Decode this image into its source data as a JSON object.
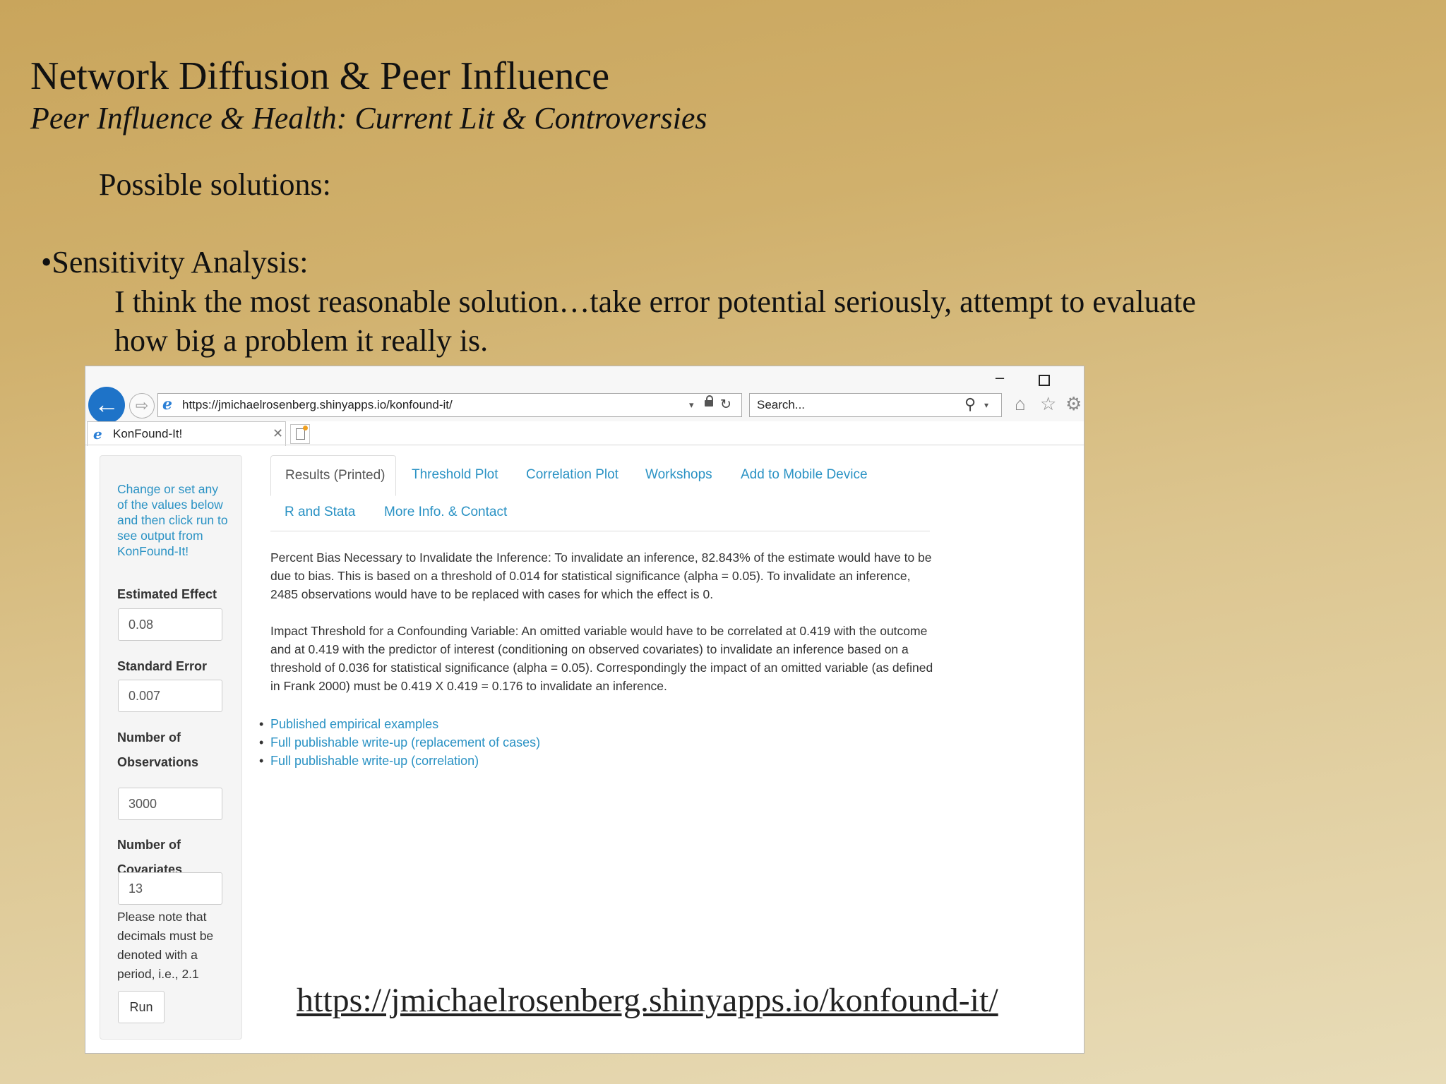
{
  "slide": {
    "title": "Network Diffusion & Peer Influence",
    "subtitle": "Peer Influence & Health: Current Lit & Controversies",
    "possible": "Possible solutions:",
    "sensitivity_heading": "•Sensitivity Analysis:",
    "sensitivity_body": "I think the most reasonable solution…take error potential seriously, attempt to evaluate how big a problem it really is.",
    "footer_url": "https://jmichaelrosenberg.shinyapps.io/konfound-it/"
  },
  "browser": {
    "minimize_glyph": "–",
    "back_glyph": "←",
    "forward_glyph": "⇨",
    "address_icon": "e",
    "address": "https://jmichaelrosenberg.shinyapps.io/konfound-it/",
    "address_dropdown_glyph": "▾",
    "refresh_glyph": "↻",
    "search_placeholder": "Search...",
    "search_glyph": "⚲",
    "search_dropdown_glyph": "▾",
    "home_glyph": "⌂",
    "star_glyph": "☆",
    "gear_glyph": "⚙",
    "tab_icon": "e",
    "tab_label": "KonFound-It!",
    "tab_close_glyph": "✕",
    "icons": [
      "back-arrow-icon",
      "forward-arrow-icon",
      "ie-logo-icon",
      "lock-icon",
      "refresh-icon",
      "search-icon",
      "home-icon",
      "star-icon",
      "gear-icon",
      "close-icon",
      "new-tab-icon"
    ]
  },
  "app": {
    "sidebar": {
      "intro": "Change or set any of the values below and then click run to see output from KonFound-It!",
      "estimated_effect_label": "Estimated Effect",
      "estimated_effect_value": "0.08",
      "standard_error_label": "Standard Error",
      "standard_error_value": "0.007",
      "observations_label": "Number of Observations",
      "observations_value": "3000",
      "covariates_label": "Number of Covariates",
      "covariates_value": "13",
      "note": "Please note that decimals must be denoted with a period, i.e., 2.1",
      "run_label": "Run"
    },
    "tabs": [
      {
        "label": "Results (Printed)"
      },
      {
        "label": "Threshold Plot"
      },
      {
        "label": "Correlation Plot"
      },
      {
        "label": "Workshops"
      },
      {
        "label": "Add to Mobile Device"
      },
      {
        "label": "R and Stata"
      },
      {
        "label": "More Info. & Contact"
      }
    ],
    "active_tab": "Results (Printed)",
    "paragraph1": "Percent Bias Necessary to Invalidate the Inference: To invalidate an inference, 82.843% of the estimate would have to be due to bias. This is based on a threshold of 0.014 for statistical significance (alpha = 0.05). To invalidate an inference, 2485 observations would have to be replaced with cases for which the effect is 0.",
    "paragraph2": "Impact Threshold for a Confounding Variable: An omitted variable would have to be correlated at 0.419 with the outcome and at 0.419 with the predictor of interest (conditioning on observed covariates) to invalidate an inference based on a threshold of 0.036 for statistical significance (alpha = 0.05). Correspondingly the impact of an omitted variable (as defined in Frank 2000) must be 0.419 X 0.419 = 0.176 to invalidate an inference.",
    "bullet_glyph": "•",
    "links": [
      {
        "label": "Published empirical examples"
      },
      {
        "label": "Full publishable write-up (replacement of cases)"
      },
      {
        "label": "Full publishable write-up (correlation)"
      }
    ],
    "colors": {
      "link": "#2a92c4",
      "text": "#333333",
      "back_button": "#1e73c8"
    }
  }
}
